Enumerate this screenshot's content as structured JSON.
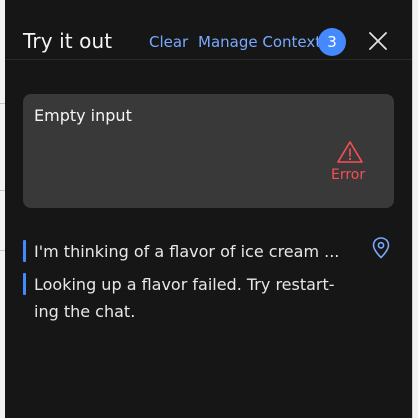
{
  "header": {
    "title": "Try it out",
    "clear_label": "Clear",
    "manage_context_label": "Manage Context",
    "context_count": "3"
  },
  "input": {
    "value": "Empty input",
    "error_label": "Error"
  },
  "messages": [
    {
      "text": "I'm thinking of a flavor of ice cream ..."
    },
    {
      "text_line1": "Looking up a flavor failed. Try restart-",
      "text_line2": "ing the chat."
    }
  ],
  "colors": {
    "accent": "#78a9ff",
    "badge": "#4589ff",
    "error": "#fa4d56",
    "panel": "#161616",
    "input_bg": "#393939"
  },
  "icons": {
    "close": "close-icon",
    "warning": "warning-triangle-icon",
    "location": "location-pin-icon"
  }
}
